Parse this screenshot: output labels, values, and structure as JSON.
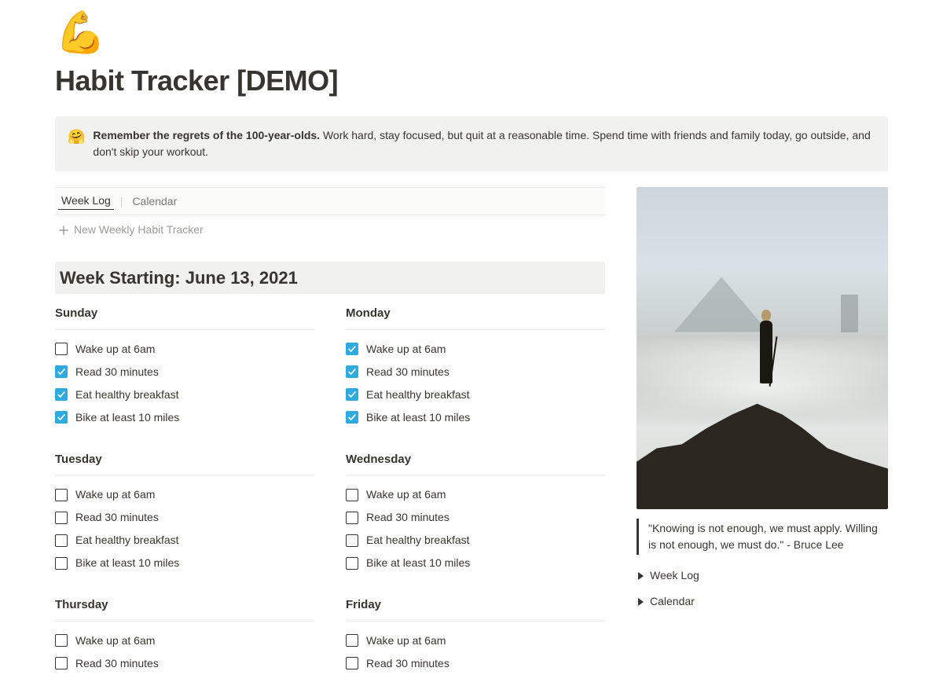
{
  "icon": "💪",
  "title": "Habit Tracker [DEMO]",
  "callout": {
    "icon": "🤗",
    "bold": "Remember the regrets of the 100-year-olds.",
    "rest": " Work hard, stay focused, but quit at a reasonable time. Spend time with friends and family today, go outside, and don't skip your workout."
  },
  "views": {
    "tab1": "Week Log",
    "tab2": "Calendar",
    "new_label": "New Weekly Habit Tracker"
  },
  "week_heading": "Week Starting: June 13, 2021",
  "habits": [
    "Wake up at 6am",
    "Read 30 minutes",
    "Eat healthy breakfast",
    "Bike at least 10 miles"
  ],
  "habits_short": [
    "Wake up at 6am",
    "Read 30 minutes"
  ],
  "days": {
    "sunday": {
      "label": "Sunday",
      "checked": [
        false,
        true,
        true,
        true
      ]
    },
    "monday": {
      "label": "Monday",
      "checked": [
        true,
        true,
        true,
        true
      ]
    },
    "tuesday": {
      "label": "Tuesday",
      "checked": [
        false,
        false,
        false,
        false
      ]
    },
    "wednesday": {
      "label": "Wednesday",
      "checked": [
        false,
        false,
        false,
        false
      ]
    },
    "thursday": {
      "label": "Thursday",
      "checked": [
        false,
        false
      ]
    },
    "friday": {
      "label": "Friday",
      "checked": [
        false,
        false
      ]
    }
  },
  "quote": "\"Knowing is not enough, we must apply. Willing is not enough, we must do.\" - Bruce Lee",
  "sidebar_toggles": {
    "weeklog": "Week Log",
    "calendar": "Calendar"
  }
}
